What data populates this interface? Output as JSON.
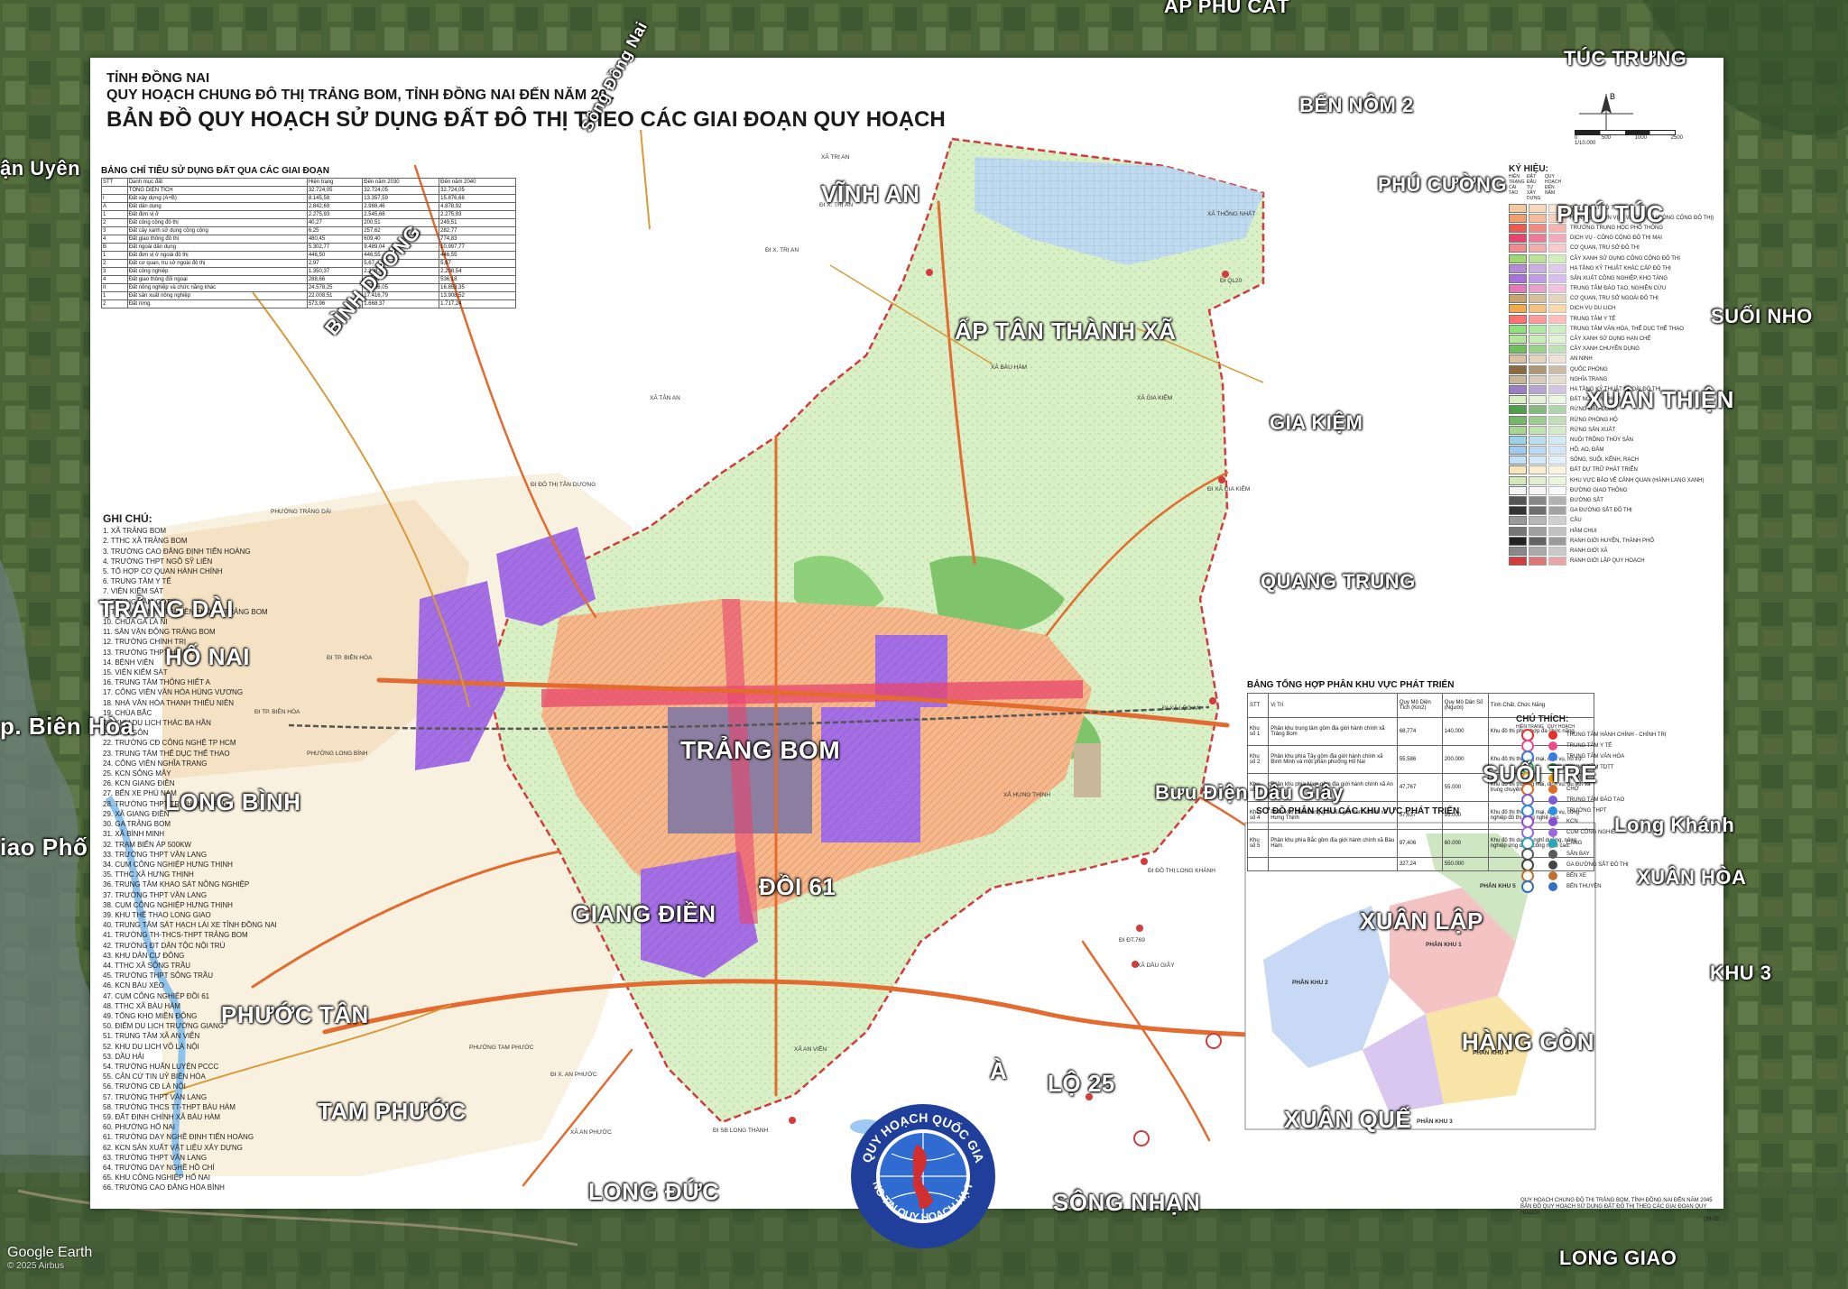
{
  "header": {
    "province": "TỈNH ĐỒNG NAI",
    "title_line1": "QUY HOẠCH CHUNG ĐÔ THỊ TRẢNG BOM, TỈNH ĐỒNG NAI ĐẾN NĂM 20..",
    "title_line2": "BẢN ĐỒ QUY HOẠCH SỬ DỤNG ĐẤT ĐÔ THỊ THEO CÁC GIAI ĐOẠN QUY HOẠCH"
  },
  "land_table": {
    "title": "BẢNG CHỈ TIÊU SỬ DỤNG ĐẤT QUA CÁC GIAI ĐOẠN",
    "headers": [
      "STT",
      "Danh mục đất",
      "Hiện trạng",
      "Đến năm 2030",
      "Đến năm 2040"
    ],
    "rows": [
      [
        "",
        "TỔNG DIỆN TÍCH",
        "32.724,05",
        "32.724,05",
        "32.724,05"
      ],
      [
        "I",
        "Đất xây dựng (A+B)",
        "8.145,58",
        "13.357,59",
        "15.876,68"
      ],
      [
        "A",
        "Đất dân dụng",
        "2.842,69",
        "2.988,46",
        "4.878,92"
      ],
      [
        "1",
        "Đất đơn vị ở",
        "2.275,93",
        "2.545,68",
        "2.275,93"
      ],
      [
        "2",
        "Đất công cộng đô thị",
        "40,27",
        "200,51",
        "249,51"
      ],
      [
        "3",
        "Đất cây xanh sử dụng công cộng",
        "6,25",
        "257,62",
        "282,77"
      ],
      [
        "4",
        "Đất giao thông đô thị",
        "480,45",
        "609,40",
        "774,83"
      ],
      [
        "B",
        "Đất ngoài dân dụng",
        "5.302,77",
        "9.489,04",
        "10.997,77"
      ],
      [
        "1",
        "Đất đơn vị ở ngoài đô thị",
        "446,50",
        "446,55",
        "446,55"
      ],
      [
        "2",
        "Đất cơ quan, trụ sở ngoài đô thị",
        "2,97",
        "5,67",
        "5,67"
      ],
      [
        "3",
        "Đất công nghiệp",
        "1.350,37",
        "2.208,54",
        "2.208,54"
      ],
      [
        "4",
        "Đất giao thông đối ngoại",
        "288,66",
        "489,57",
        "536,18"
      ],
      [
        "II",
        "Đất nông nghiệp và chức năng khác",
        "24.578,25",
        "19.706,05",
        "16.853,35"
      ],
      [
        "1",
        "Đất sản xuất nông nghiệp",
        "22.008,51",
        "17.416,79",
        "13.908,52"
      ],
      [
        "2",
        "Đất rừng",
        "573,96",
        "1.668,37",
        "1.717,24"
      ]
    ]
  },
  "notes": {
    "title": "GHI CHÚ:",
    "items": [
      "1. XÃ TRẢNG BOM",
      "2. TTHC XÃ TRẢNG BOM",
      "3. TRƯỜNG CAO ĐẲNG ĐỊNH TIẾN HOÀNG",
      "4. TRƯỜNG THPT NGÔ SỸ LIÊN",
      "5. TỔ HỢP CƠ QUAN HÀNH CHÍNH",
      "6. TRUNG TÂM Y TẾ",
      "7. VIỆN KIỂM SÁT",
      "8. TRUNG TÂM GDTX",
      "9. THƯ VIỆN NHÀ TRUYỀN THỐNG TRẢNG BOM",
      "10. CHÙA GÀ LÀ NI",
      "11. SÂN VẬN ĐỘNG TRẢNG BOM",
      "12. TRƯỜNG CHÍNH TRỊ",
      "13. TRƯỜNG THPT HỌ NAI",
      "14. BỆNH VIỆN",
      "15. VIỆN KIỂM SÁT",
      "16. TRUNG TÂM THÔNG HIẾT A",
      "17. CÔNG VIÊN VĂN HÓA HÙNG VƯƠNG",
      "18. NHÀ VĂN HÓA THANH THIẾU NIÊN",
      "19. CHÙA BẮC",
      "20. KHU DU LỊCH THÁC BA HẦN",
      "21. SÂN GÔN",
      "22. TRƯỜNG CĐ CÔNG NGHỆ TP HCM",
      "23. TRUNG TÂM THỂ DỤC THỂ THAO",
      "24. CÔNG VIÊN NGHĨA TRANG",
      "25. KCN SÔNG MÂY",
      "26. KCN GIANG ĐIỀN",
      "27. BẾN XE PHÚ NAM",
      "28. TRƯỜNG THPT TRỊNH HOÀI ĐỨC",
      "29. XÃ GIANG ĐIỀN",
      "30. GA TRẢNG BOM",
      "31. XÃ BÌNH MINH",
      "32. TRẠM BIẾN ÁP 500KW",
      "33. TRƯỜNG THPT VĂN LANG",
      "34. CỤM CÔNG NGHIỆP HƯNG THỊNH",
      "35. TTHC XÃ HƯNG THỊNH",
      "36. TRUNG TÂM KHAO SÁT NÔNG NGHIỆP",
      "37. TRƯỜNG THPT VĂN LANG",
      "38. CỤM CÔNG NGHIỆP HƯNG THỊNH",
      "39. KHU THỂ THAO LONG GIAO",
      "40. TRUNG TÂM SÁT HẠCH LÁI XE TỈNH ĐỒNG NAI",
      "41. TRƯỜNG TH-THCS-THPT TRẢNG BOM",
      "42. TRƯỜNG ĐT DÂN TỘC NỘI TRÚ",
      "43. KHU DÂN CƯ ĐÔNG",
      "44. TTHC XÃ SÔNG TRẦU",
      "45. TRƯỜNG THPT SÔNG TRẦU",
      "46. KCN BÀU XÉO",
      "47. CỤM CÔNG NGHIỆP ĐỒI 61",
      "48. TTHC XÃ BÀU HÀM",
      "49. TỔNG KHO MIỀN ĐÔNG",
      "50. ĐIỂM DU LỊCH TRƯỜNG GIANG",
      "51. TRUNG TÂM XÃ AN VIỄN",
      "52. KHU DU LỊCH VÕ LÀ NỘI",
      "53. DẦU HẢI",
      "54. TRƯỜNG HUẤN LUYỆN PCCC",
      "55. CẢN CỨ TIN UỶ BIÊN HÒA",
      "56. TRƯỜNG CĐ LÀ NỘI",
      "57. TRƯỜNG THPT VĂN LANG",
      "58. TRƯỜNG THCS TT-THPT BÀU HÀM",
      "59. ĐẤT ĐỊNH CHÍNH XÃ BÀU HÀM",
      "60. PHƯỜNG HỐ NAI",
      "61. TRƯỜNG DẠY NGHỀ ĐỊNH TIẾN HOÀNG",
      "62. KCN SẢN XUẤT VẬT LIỆU XÂY DỰNG",
      "63. TRƯỜNG THPT VĂN LANG",
      "64. TRƯỜNG DẠY NGHỀ HỒ CHÍ",
      "65. KHU CÔNG NGHIỆP HỐ NAI",
      "66. TRƯỜNG CAO ĐẲNG HÒA BÌNH"
    ]
  },
  "legend": {
    "title": "KÝ HIỆU:",
    "col_headers": [
      "HIỆN TRẠNG CẢI TẠO",
      "ĐẤT ĐẦU TƯ XÂY DỰNG",
      "QUY HOẠCH ĐẾN NĂM"
    ],
    "items": [
      {
        "label": "ĐẤT Ở MẬT ĐỘ THẤP",
        "color": "#f6c9a3"
      },
      {
        "label": "HỖN HỢP (ĐƠN VỊ Ở VÀ DỊCH VỤ CÔNG CỘNG ĐÔ THỊ)",
        "color": "#f0a070"
      },
      {
        "label": "TRƯỜNG TRUNG HỌC PHỔ THÔNG",
        "color": "#ee5a4e"
      },
      {
        "label": "DỊCH VỤ - CÔNG CỘNG ĐÔ THỊ MẠI",
        "color": "#e8456e"
      },
      {
        "label": "CƠ QUAN, TRỤ SỞ ĐÔ THỊ",
        "color": "#f28c8c"
      },
      {
        "label": "CÂY XANH SỬ DỤNG CÔNG CỘNG ĐÔ THỊ",
        "color": "#9ed86f"
      },
      {
        "label": "HẠ TẦNG KỸ THUẬT KHÁC CẤP ĐÔ THỊ",
        "color": "#b58bd6"
      },
      {
        "label": "SẢN XUẤT CÔNG NGHIỆP, KHO TÀNG",
        "color": "#a970e0"
      },
      {
        "label": "TRUNG TÂM ĐÀO TẠO, NGHIÊN CỨU",
        "color": "#e07ab8"
      },
      {
        "label": "CƠ QUAN, TRỤ SỞ NGOÀI ĐÔ THỊ",
        "color": "#c8a46e"
      },
      {
        "label": "DỊCH VỤ DU LỊCH",
        "color": "#f2a94a"
      },
      {
        "label": "TRUNG TÂM Y TẾ",
        "color": "#ff7070"
      },
      {
        "label": "TRUNG TÂM VĂN HÓA, THỂ DỤC THỂ THAO",
        "color": "#8de07a"
      },
      {
        "label": "CÂY XANH SỬ DỤNG HẠN CHẾ",
        "color": "#b5e59b"
      },
      {
        "label": "CÂY XANH CHUYÊN DỤNG",
        "color": "#6fbf5a"
      },
      {
        "label": "AN NINH",
        "color": "#d9c1a3"
      },
      {
        "label": "QUỐC PHÒNG",
        "color": "#8c6a3f"
      },
      {
        "label": "NGHĨA TRANG",
        "color": "#c9b79a"
      },
      {
        "label": "HẠ TẦNG KỸ THUẬT NGOÀI ĐÔ THỊ",
        "color": "#9a7fc0"
      },
      {
        "label": "ĐẤT NÔNG NGHIỆP",
        "color": "#d7efc1"
      },
      {
        "label": "RỪNG ĐẶC DỤNG",
        "color": "#4f9e4a"
      },
      {
        "label": "RỪNG PHÒNG HỘ",
        "color": "#72b866"
      },
      {
        "label": "RỪNG SẢN XUẤT",
        "color": "#a4d68e"
      },
      {
        "label": "NUÔI TRỒNG THỦY SẢN",
        "color": "#9bd1e6"
      },
      {
        "label": "HỒ, AO, ĐẦM",
        "color": "#9ec9f2"
      },
      {
        "label": "SÔNG, SUỐI, KÊNH, RẠCH",
        "color": "#bfe0f7"
      },
      {
        "label": "ĐẤT DỰ TRỮ PHÁT TRIỂN",
        "color": "#f7e7b8"
      },
      {
        "label": "KHU VỰC BẢO VỆ CẢNH QUAN (HÀNH LANG XANH)",
        "color": "#d2eab7"
      },
      {
        "label": "ĐƯỜNG GIAO THÔNG",
        "color": "#f3f3f3"
      },
      {
        "label": "ĐƯỜNG SẮT",
        "color": "#555555"
      },
      {
        "label": "GA ĐƯỜNG SẮT ĐÔ THỊ",
        "color": "#333333"
      },
      {
        "label": "CẦU",
        "color": "#999999"
      },
      {
        "label": "HẦM CHUI",
        "color": "#777777"
      },
      {
        "label": "RANH GIỚI HUYỆN, THÀNH PHỐ",
        "color": "#222222"
      },
      {
        "label": "RANH GIỚI XÃ",
        "color": "#888888"
      },
      {
        "label": "RANH GIỚI LẬP QUY HOẠCH",
        "color": "#d23c3c"
      }
    ]
  },
  "symbols": {
    "title": "CHÚ THÍCH:",
    "col_headers": [
      "HIỆN TRẠNG",
      "QUY HOẠCH"
    ],
    "items": [
      {
        "label": "TRUNG TÂM HÀNH CHÍNH - CHÍNH TRỊ",
        "color": "#e03030"
      },
      {
        "label": "TRUNG TÂM Y TẾ",
        "color": "#e84d8a"
      },
      {
        "label": "TRUNG TÂM VĂN HÓA",
        "color": "#3a7be0"
      },
      {
        "label": "TRUNG TÂM TDTT",
        "color": "#39a85a"
      },
      {
        "label": "TTTM",
        "color": "#f0a020"
      },
      {
        "label": "CHỢ",
        "color": "#d96b2b"
      },
      {
        "label": "TRUNG TÂM ĐÀO TẠO",
        "color": "#7a5bd6"
      },
      {
        "label": "TRƯỜNG THPT",
        "color": "#2b8fd9"
      },
      {
        "label": "KCN",
        "color": "#8a4fd0"
      },
      {
        "label": "CỤM CÔNG NGHIỆP",
        "color": "#9b6ad8"
      },
      {
        "label": "CẢNG",
        "color": "#2aa6b8"
      },
      {
        "label": "SÂN BAY",
        "color": "#5a5a5a"
      },
      {
        "label": "GA ĐƯỜNG SẮT ĐÔ THỊ",
        "color": "#444444"
      },
      {
        "label": "BẾN XE",
        "color": "#c07030"
      },
      {
        "label": "BẾN THUYỀN",
        "color": "#3070c0"
      }
    ]
  },
  "zone_table": {
    "title": "BẢNG TỔNG HỢP PHÂN KHU VỰC PHÁT TRIỂN",
    "headers": [
      "STT",
      "Vị Trí",
      "Quy Mô Diện Tích (Km2)",
      "Quy Mô Dân Số (Người)",
      "Tính Chất, Chức Năng"
    ],
    "rows": [
      [
        "Khu số 1",
        "Phân khu trung tâm gồm địa giới hành chính xã Trảng Bom",
        "68,774",
        "140.000",
        "Khu đô thị phức hợp đa chức năng."
      ],
      [
        "Khu số 2",
        "Phân khu phía Tây gồm địa giới hành chính xã Bình Minh và một phần phường Hố Nai",
        "55,586",
        "200.000",
        "Khu đô thị thương mại, dịch vụ, hỗ trợ."
      ],
      [
        "Khu số 3",
        "Phân khu phía Nam gồm địa giới hành chính xã An Viễn",
        "47,767",
        "55.000",
        "Khu đô thị thương mại, dịch vụ, du lịch và trung chuyển."
      ],
      [
        "Khu số 4",
        "Phân khu phía Đông gồm địa giới hành chính xã Hưng Thịnh",
        "57,637",
        "95.000",
        "Khu đô thị thương mại, dịch vụ, công nghiệp đô thị công nghệ cao."
      ],
      [
        "Khu số 5",
        "Phân khu phía Bắc gồm địa giới hành chính xã Bàu Hàm",
        "97,406",
        "60.000",
        "Khu đô thị du lịch nghỉ dưỡng, nông nghiệp ứng dụng công nghệ cao."
      ],
      [
        "",
        "",
        "327,24",
        "550.000",
        ""
      ]
    ]
  },
  "zone_map": {
    "title": "SƠ ĐỒ PHÂN KHU CÁC KHU VỰC PHÁT TRIỂN",
    "zones": [
      "PHÂN KHU 1",
      "PHÂN KHU 2",
      "PHÂN KHU 3",
      "PHÂN KHU 4",
      "PHÂN KHU 5"
    ]
  },
  "places": {
    "ap_phu_cat": "ẤP PHÚ CÁT",
    "tuc_trung": "TÚC TRƯNG",
    "ben_nom_2": "BẾN NÔM 2",
    "phu_cuong": "PHÚ CƯỜNG",
    "phu_tuc": "PHÚ TÚC",
    "suoi_nho": "SUỐI NHO",
    "xuan_thien": "XUÂN THIỆN",
    "vinh_an": "VĨNH AN",
    "ap_tan_thanh_xa": "ẤP TÂN THÀNH XÃ",
    "gia_kiem": "GIA KIỆM",
    "quang_trung": "QUANG TRUNG",
    "binh_duong": "BÌNH DƯƠNG",
    "song_dong_nai": "Sông Đồng Nai",
    "tan_uyen": "ận Uyên",
    "trang_dai": "TRẢNG DÀI",
    "ho_nai": "HỐ NAI",
    "bien_hoa": "p. Biên Hòa",
    "long_binh": "LONG BÌNH",
    "giao_pho": "iao Phố",
    "trang_bom": "TRẢNG BOM",
    "doi_61": "ĐỒI 61",
    "giang_dien": "GIANG ĐIỀN",
    "buu_dien_dau_giay": "Bưu Điện Dầu Giây",
    "suoi_tre": "SUỐI TRE",
    "long_khanh": "Long Khánh",
    "xuan_hoa": "XUÂN HÒA",
    "khu_3": "KHU 3",
    "xuan_lap": "XUÂN LẬP",
    "hang_gon": "HÀNG GÒN",
    "xuan_que": "XUÂN QUẾ",
    "phuoc_tan": "PHƯỚC TÂN",
    "tam_phuoc": "TAM PHƯỚC",
    "lo_25": "LỘ 25",
    "long_duc": "LONG ĐỨC",
    "song_nhan": "SÔNG NHẠN",
    "long_giao": "LONG GIAO",
    "a": "À"
  },
  "map_labels": {
    "xa_tri_an": "XÃ TRỊ AN",
    "di_x_tri_an": "ĐI X. TRỊ AN",
    "xa_thong_nhat": "XÃ THỐNG NHẤT",
    "di_ql20": "ĐI QL20",
    "xa_tan_an": "XÃ TÂN AN",
    "xa_bau_ham": "XÃ BÀU HÀM",
    "xa_gia_kiem": "XÃ GIA KIỆM",
    "di_xa_gia_kiem": "ĐI XÃ GIA KIỆM",
    "di_do_thi_tan_duong": "ĐI ĐÔ THỊ TÂN DƯƠNG",
    "phuong_trang_dai": "PHƯỜNG TRẢNG DÀI",
    "di_tp_bien_hoa": "ĐI TP. BIÊN HÒA",
    "phuong_long_binh": "PHƯỜNG LONG BÌNH",
    "xa_hung_thinh": "XÃ HƯNG THỊNH",
    "di_xa_loc_an": "ĐI XÃ LỘC AN",
    "di_do_thi_long_khanh": "ĐI ĐÔ THỊ LONG KHÁNH",
    "xa_dau_giay": "XÃ DẦU GIÂY",
    "di_dt_769": "ĐI ĐT.769",
    "phuong_tam_phuoc": "PHƯỜNG TAM PHƯỚC",
    "xa_an_vien": "XÃ AN VIỄN",
    "xa_an_phuoc": "XÃ AN PHƯỚC",
    "di_sb_long_thanh": "ĐI SB LONG THÀNH",
    "di_x_an_phuoc": "ĐI X. AN PHƯỚC",
    "xa_dau_giay2": "XÃ DẦU GIÂY"
  },
  "seal": {
    "top_text": "QUY HOẠCH QUỐC GIA",
    "bottom_text": "THÔNG TIN QUY HOẠCH-HẠ TẦNG"
  },
  "compass": {
    "north": "B"
  },
  "scale": {
    "ticks": [
      "0",
      "500",
      "1000",
      "2500"
    ],
    "ratio": "1/10.000"
  },
  "bottom_note": {
    "line1": "QUY HOẠCH CHUNG ĐÔ THỊ TRẢNG BOM, TỈNH ĐỒNG NAI ĐẾN NĂM 2045",
    "line2": "BẢN ĐỒ QUY HOẠCH SỬ DỤNG ĐẤT ĐÔ THỊ THEO CÁC GIAI ĐOẠN QUY HOẠCH",
    "sheet": "QH-05"
  },
  "watermark": {
    "brand": "Google Earth",
    "copyright": "© 2025 Airbus"
  }
}
